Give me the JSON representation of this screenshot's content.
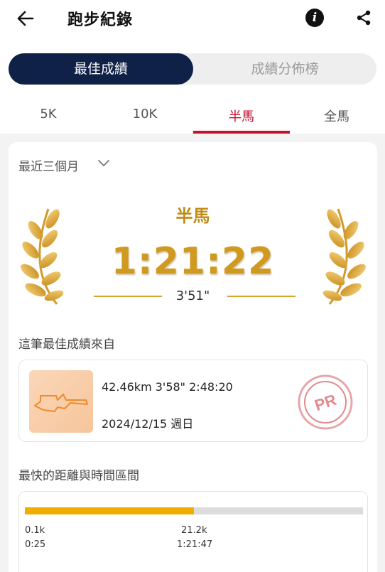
{
  "header": {
    "title": "跑步紀錄",
    "back_icon": "arrow-left-icon",
    "info_icon": "info-icon",
    "share_icon": "share-icon"
  },
  "segment": {
    "active": "最佳成績",
    "inactive": "成績分佈榜"
  },
  "tabs": [
    {
      "label": "5K",
      "active": false
    },
    {
      "label": "10K",
      "active": false
    },
    {
      "label": "半馬",
      "active": true
    },
    {
      "label": "全馬",
      "active": false
    }
  ],
  "period": {
    "label": "最近三個月",
    "icon": "chevron-down-icon"
  },
  "best": {
    "race": "半馬",
    "time": "1:21:22",
    "pace": "3'51\""
  },
  "source": {
    "title": "這筆最佳成績來自",
    "stats": "42.46km  3'58\"  2:48:20",
    "date": "2024/12/15 週日",
    "badge": "PR"
  },
  "fastest": {
    "title": "最快的距離與時間區間",
    "start_distance": "0.1k",
    "start_time": "0:25",
    "end_distance": "21.2k",
    "end_time": "1:21:47",
    "fill_fraction": 0.5
  },
  "colors": {
    "navy": "#0f2147",
    "red": "#c8102e",
    "gold": "#cf9a1f",
    "bar": "#f0ad00",
    "pr": "#e08a8f"
  }
}
